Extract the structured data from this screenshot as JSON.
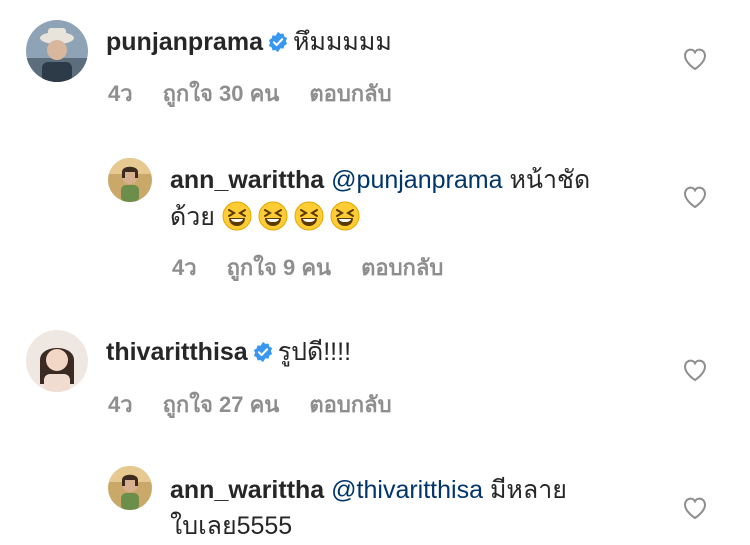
{
  "comments": [
    {
      "username": "punjanprama",
      "verified": true,
      "text": "หึมมมมม",
      "time": "4ว",
      "likes": "ถูกใจ 30 คน",
      "reply": "ตอบกลับ"
    },
    {
      "username": "ann_warittha",
      "verified": false,
      "mention": "@punjanprama",
      "text_line1": "หน้าชัด",
      "text_line2": "ด้วย",
      "emoji": "grinning-squinting-face",
      "emoji_count": 4,
      "time": "4ว",
      "likes": "ถูกใจ 9 คน",
      "reply": "ตอบกลับ"
    },
    {
      "username": "thivaritthisa",
      "verified": true,
      "text": "รูปดี!!!!",
      "time": "4ว",
      "likes": "ถูกใจ 27 คน",
      "reply": "ตอบกลับ"
    },
    {
      "username": "ann_warittha",
      "verified": false,
      "mention": "@thivaritthisa",
      "text_line1": "มีหลาย",
      "text_line2": "ใบเลย5555"
    }
  ],
  "colors": {
    "text": "#262626",
    "meta": "#8e8e8e",
    "mention": "#003569",
    "verified": "#3897f0"
  },
  "icons": {
    "like": "heart-outline-icon",
    "verified": "verified-badge-icon"
  }
}
